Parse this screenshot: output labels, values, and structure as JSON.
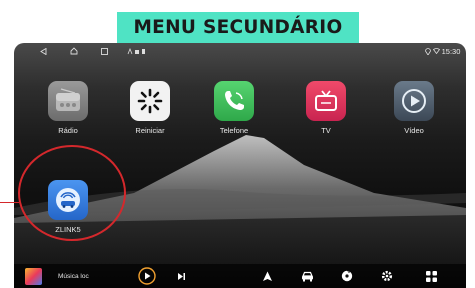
{
  "banner": {
    "title": "MENU SECUNDÁRIO"
  },
  "statusbar": {
    "clock": "15:30"
  },
  "apps": [
    {
      "label": "Rádio",
      "icon": "radio-icon"
    },
    {
      "label": "Reiniciar",
      "icon": "restart-icon"
    },
    {
      "label": "Telefone",
      "icon": "phone-icon"
    },
    {
      "label": "TV",
      "icon": "tv-icon"
    },
    {
      "label": "Vídeo",
      "icon": "video-play-icon"
    },
    {
      "label": "ZLINK5",
      "icon": "zlink-car-icon"
    }
  ],
  "dock": {
    "media_title": "Música loc",
    "icons": [
      "play-icon",
      "next-icon",
      "navigation-icon",
      "car-icon",
      "music-disc-icon",
      "settings-gear-icon",
      "grid-apps-icon"
    ]
  },
  "colors": {
    "banner": "#4fe3c4",
    "highlight": "#d4282c",
    "phone": "#3fbf5a",
    "tv": "#e8345a",
    "zlink": "#2f7fe6"
  }
}
